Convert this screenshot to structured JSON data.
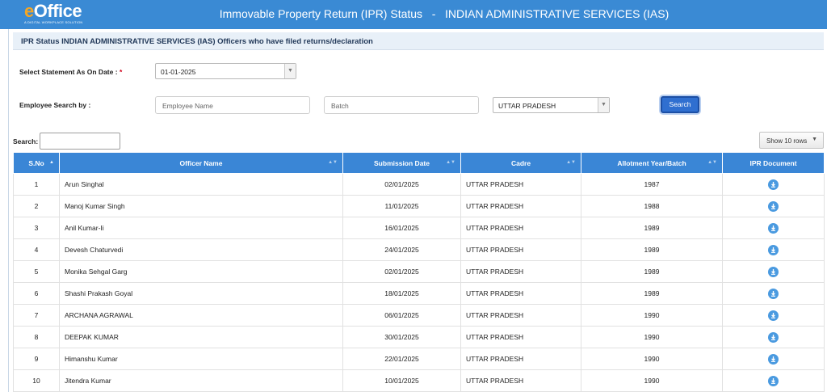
{
  "header": {
    "logo_text_e": "e",
    "logo_text_rest": "Office",
    "logo_sub": "A DIGITAL WORKPLACE SOLUTION",
    "title": "Immovable Property Return (IPR) Status   -   INDIAN ADMINISTRATIVE SERVICES (IAS)"
  },
  "section": {
    "heading": "IPR Status INDIAN ADMINISTRATIVE SERVICES (IAS) Officers who have filed returns/declaration"
  },
  "filters": {
    "statement_label": "Select Statement As On Date :",
    "required_mark": "*",
    "statement_date": "01-01-2025",
    "employee_search_label": "Employee Search by :",
    "employee_name_placeholder": "Employee Name",
    "batch_placeholder": "Batch",
    "cadre_selected": "UTTAR PRADESH",
    "search_button": "Search"
  },
  "table_controls": {
    "search_label": "Search:",
    "search_value": "",
    "show_rows": "Show 10 rows"
  },
  "table": {
    "columns": [
      "S.No",
      "Officer Name",
      "Submission Date",
      "Cadre",
      "Allotment Year/Batch",
      "IPR Document"
    ],
    "rows": [
      [
        "1",
        "Arun Singhal",
        "02/01/2025",
        "UTTAR PRADESH",
        "1987"
      ],
      [
        "2",
        "Manoj Kumar Singh",
        "11/01/2025",
        "UTTAR PRADESH",
        "1988"
      ],
      [
        "3",
        "Anil Kumar-Ii",
        "16/01/2025",
        "UTTAR PRADESH",
        "1989"
      ],
      [
        "4",
        "Devesh Chaturvedi",
        "24/01/2025",
        "UTTAR PRADESH",
        "1989"
      ],
      [
        "5",
        "Monika Sehgal Garg",
        "02/01/2025",
        "UTTAR PRADESH",
        "1989"
      ],
      [
        "6",
        "Shashi Prakash Goyal",
        "18/01/2025",
        "UTTAR PRADESH",
        "1989"
      ],
      [
        "7",
        "ARCHANA AGRAWAL",
        "06/01/2025",
        "UTTAR PRADESH",
        "1990"
      ],
      [
        "8",
        "DEEPAK KUMAR",
        "30/01/2025",
        "UTTAR PRADESH",
        "1990"
      ],
      [
        "9",
        "Himanshu Kumar",
        "22/01/2025",
        "UTTAR PRADESH",
        "1990"
      ],
      [
        "10",
        "Jitendra Kumar",
        "10/01/2025",
        "UTTAR PRADESH",
        "1990"
      ]
    ]
  },
  "colors": {
    "header_bg": "#3a8ad4",
    "table_header_bg": "#3a86d6",
    "search_button_bg": "#2f6fd0",
    "download_icon": "#4a9ae0"
  }
}
